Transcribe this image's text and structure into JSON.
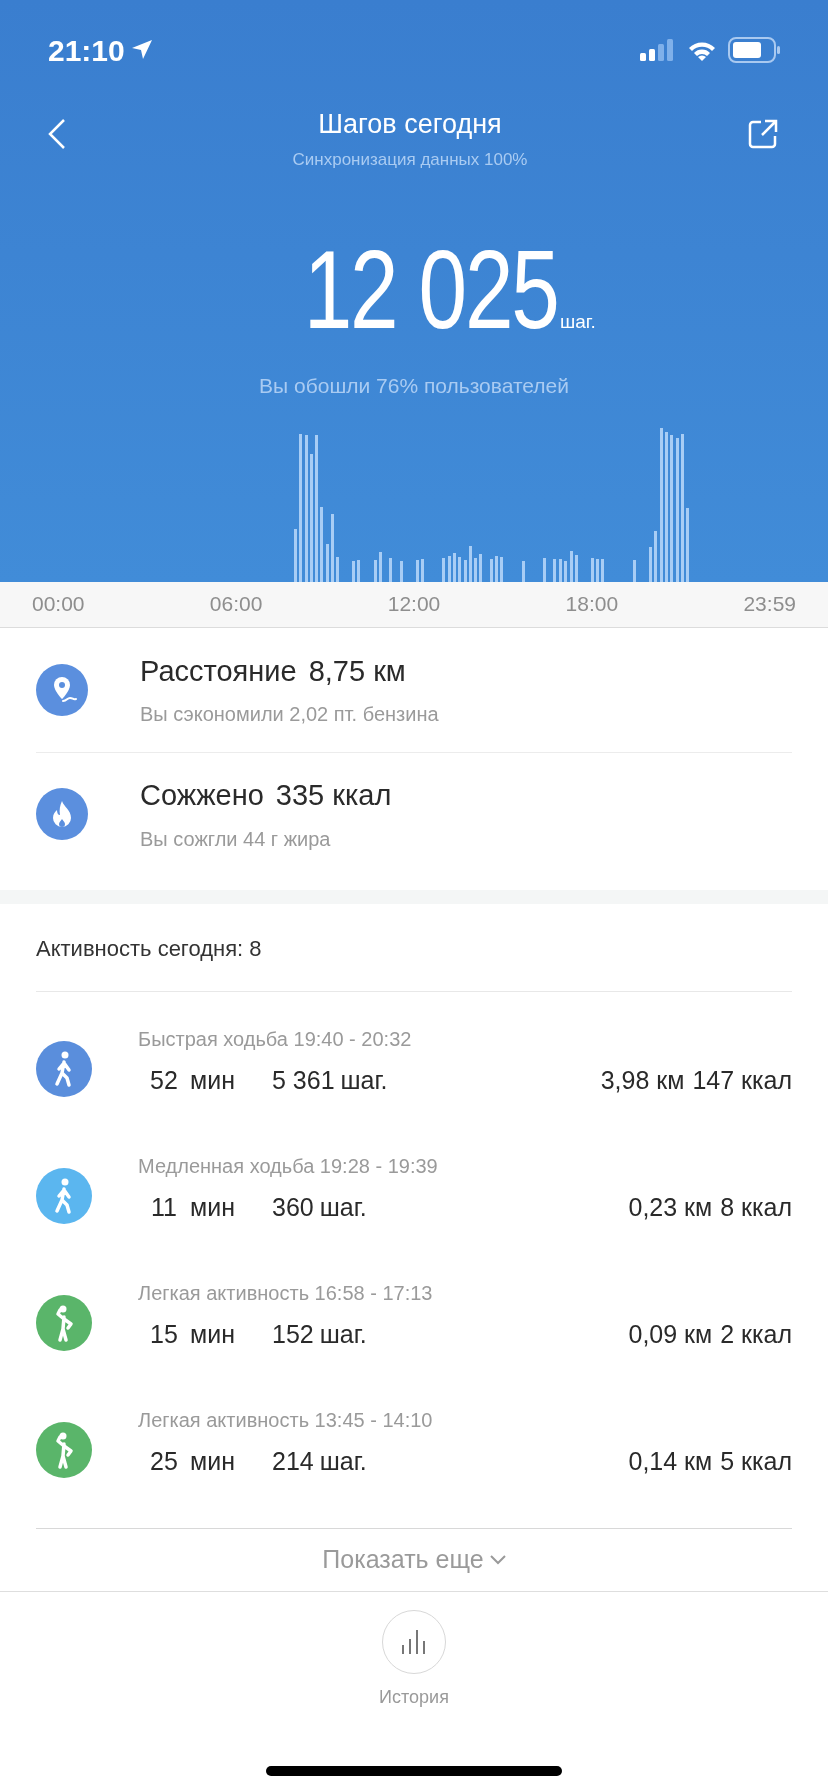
{
  "status_bar": {
    "time": "21:10"
  },
  "header": {
    "title": "Шагов сегодня",
    "subtitle": "Синхронизация данных 100%"
  },
  "steps": {
    "value": "12 025",
    "unit": "шаг.",
    "comparison": "Вы обошли 76% пользователей"
  },
  "axis_labels": [
    "00:00",
    "06:00",
    "12:00",
    "18:00",
    "23:59"
  ],
  "stats": [
    {
      "kind": "distance",
      "label": "Расстояние",
      "value": "8,75 км",
      "note": "Вы сэкономили 2,02 пт. бензина"
    },
    {
      "kind": "calories",
      "label": "Сожжено",
      "value": "335 ккал",
      "note": "Вы сожгли 44 г жира"
    }
  ],
  "activity": {
    "title": "Активность сегодня: 8",
    "items": [
      {
        "kind": "fast_walk",
        "title": "Быстрая ходьба 19:40 - 20:32",
        "minutes": "52",
        "minutes_unit": "мин",
        "steps": "5 361",
        "steps_unit": "шаг.",
        "distance": "3,98 км",
        "calories": "147 ккал"
      },
      {
        "kind": "slow_walk",
        "title": "Медленная ходьба 19:28 - 19:39",
        "minutes": "11",
        "minutes_unit": "мин",
        "steps": "360",
        "steps_unit": "шаг.",
        "distance": "0,23 км",
        "calories": "8 ккал"
      },
      {
        "kind": "light",
        "title": "Легкая активность 16:58 - 17:13",
        "minutes": "15",
        "minutes_unit": "мин",
        "steps": "152",
        "steps_unit": "шаг.",
        "distance": "0,09 км",
        "calories": "2 ккал"
      },
      {
        "kind": "light",
        "title": "Легкая активность 13:45 - 14:10",
        "minutes": "25",
        "minutes_unit": "мин",
        "steps": "214",
        "steps_unit": "шаг.",
        "distance": "0,14 км",
        "calories": "5 ккал"
      }
    ],
    "show_more": "Показать еще"
  },
  "bottom_nav": {
    "label": "История"
  }
}
